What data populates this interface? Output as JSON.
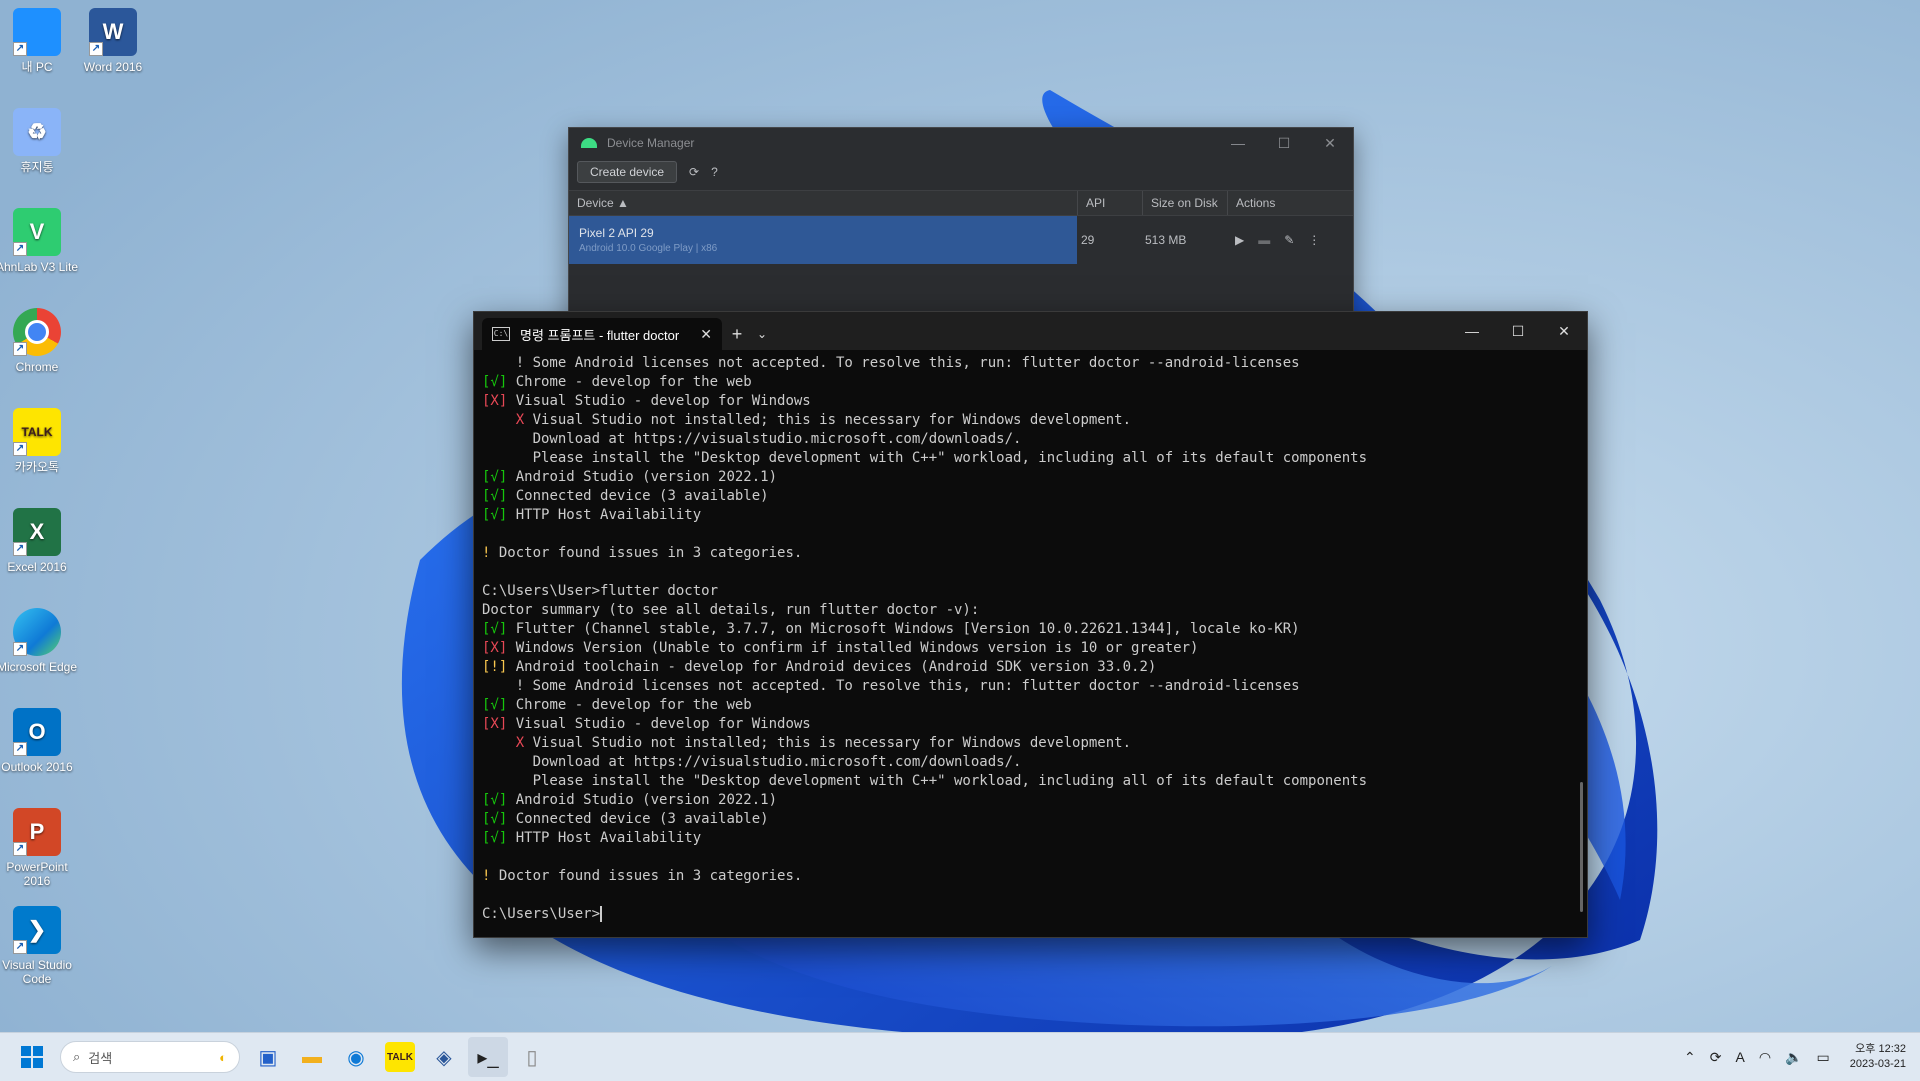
{
  "desktop_icons": [
    {
      "label": "내 PC",
      "icon": "monitor-icon",
      "color": "#1e90ff"
    },
    {
      "label": "Word 2016",
      "icon": "word-icon",
      "color": "#2b579a",
      "glyph": "W"
    },
    {
      "label": "휴지통",
      "icon": "recycle-bin-icon",
      "color": "#8ab4f8"
    },
    {
      "label": "AhnLab V3 Lite",
      "icon": "ahnlab-icon",
      "color": "#2ecc71",
      "glyph": "V"
    },
    {
      "label": "Chrome",
      "icon": "chrome-icon",
      "color": "#ea4335"
    },
    {
      "label": "카카오톡",
      "icon": "kakaotalk-icon",
      "color": "#fee500",
      "glyph": "TALK"
    },
    {
      "label": "Excel 2016",
      "icon": "excel-icon",
      "color": "#217346",
      "glyph": "X"
    },
    {
      "label": "Microsoft Edge",
      "icon": "edge-icon",
      "color": "#0f7ad6"
    },
    {
      "label": "Outlook 2016",
      "icon": "outlook-icon",
      "color": "#0072c6",
      "glyph": "O"
    },
    {
      "label": "PowerPoint 2016",
      "icon": "powerpoint-icon",
      "color": "#d24726",
      "glyph": "P"
    },
    {
      "label": "Visual Studio Code",
      "icon": "vscode-icon",
      "color": "#007acc",
      "glyph": "❯"
    }
  ],
  "device_manager": {
    "title": "Device Manager",
    "create_button": "Create device",
    "help": "?",
    "columns": [
      "Device ▲",
      "API",
      "Size on Disk",
      "Actions"
    ],
    "device": {
      "name": "Pixel 2 API 29",
      "subtitle": "Android 10.0 Google Play | x86",
      "api": "29",
      "size": "513 MB"
    }
  },
  "terminal": {
    "tab_title": "명령 프롬프트 - flutter doctor",
    "lines": [
      [
        [
          "",
          "    ! Some Android licenses not accepted. To resolve this, run: flutter doctor --android-licenses"
        ]
      ],
      [
        [
          "g",
          "[√]"
        ],
        [
          "",
          " Chrome - develop for the web"
        ]
      ],
      [
        [
          "r",
          "[X]"
        ],
        [
          "",
          " Visual Studio - develop for Windows"
        ]
      ],
      [
        [
          "",
          "    "
        ],
        [
          "r",
          "X"
        ],
        [
          "",
          " Visual Studio not installed; this is necessary for Windows development."
        ]
      ],
      [
        [
          "",
          "      Download at https://visualstudio.microsoft.com/downloads/."
        ]
      ],
      [
        [
          "",
          "      Please install the \"Desktop development with C++\" workload, including all of its default components"
        ]
      ],
      [
        [
          "g",
          "[√]"
        ],
        [
          "",
          " Android Studio (version 2022.1)"
        ]
      ],
      [
        [
          "g",
          "[√]"
        ],
        [
          "",
          " Connected device (3 available)"
        ]
      ],
      [
        [
          "g",
          "[√]"
        ],
        [
          "",
          " HTTP Host Availability"
        ]
      ],
      [
        [
          "",
          ""
        ]
      ],
      [
        [
          "yy",
          "!"
        ],
        [
          "",
          " Doctor found issues in 3 categories."
        ]
      ],
      [
        [
          "",
          ""
        ]
      ],
      [
        [
          "",
          "C:\\Users\\User>flutter doctor"
        ]
      ],
      [
        [
          "",
          "Doctor summary (to see all details, run flutter doctor -v):"
        ]
      ],
      [
        [
          "g",
          "[√]"
        ],
        [
          "",
          " Flutter (Channel stable, 3.7.7, on Microsoft Windows [Version 10.0.22621.1344], locale ko-KR)"
        ]
      ],
      [
        [
          "r",
          "[X]"
        ],
        [
          "",
          " Windows Version (Unable to confirm if installed Windows version is 10 or greater)"
        ]
      ],
      [
        [
          "yy",
          "[!]"
        ],
        [
          "",
          " Android toolchain - develop for Android devices (Android SDK version 33.0.2)"
        ]
      ],
      [
        [
          "",
          "    ! Some Android licenses not accepted. To resolve this, run: flutter doctor --android-licenses"
        ]
      ],
      [
        [
          "g",
          "[√]"
        ],
        [
          "",
          " Chrome - develop for the web"
        ]
      ],
      [
        [
          "r",
          "[X]"
        ],
        [
          "",
          " Visual Studio - develop for Windows"
        ]
      ],
      [
        [
          "",
          "    "
        ],
        [
          "r",
          "X"
        ],
        [
          "",
          " Visual Studio not installed; this is necessary for Windows development."
        ]
      ],
      [
        [
          "",
          "      Download at https://visualstudio.microsoft.com/downloads/."
        ]
      ],
      [
        [
          "",
          "      Please install the \"Desktop development with C++\" workload, including all of its default components"
        ]
      ],
      [
        [
          "g",
          "[√]"
        ],
        [
          "",
          " Android Studio (version 2022.1)"
        ]
      ],
      [
        [
          "g",
          "[√]"
        ],
        [
          "",
          " Connected device (3 available)"
        ]
      ],
      [
        [
          "g",
          "[√]"
        ],
        [
          "",
          " HTTP Host Availability"
        ]
      ],
      [
        [
          "",
          ""
        ]
      ],
      [
        [
          "yy",
          "!"
        ],
        [
          "",
          " Doctor found issues in 3 categories."
        ]
      ],
      [
        [
          "",
          ""
        ]
      ]
    ],
    "prompt": "C:\\Users\\User>"
  },
  "taskbar": {
    "search_placeholder": "검색",
    "apps": [
      "windows-start-icon",
      "store-icon",
      "file-explorer-icon",
      "edge-icon",
      "kakaotalk-icon",
      "word-taskbar-icon",
      "terminal-icon",
      "notepad-icon"
    ],
    "ime": "A",
    "clock_time": "오후 12:32",
    "clock_date": "2023-03-21"
  }
}
